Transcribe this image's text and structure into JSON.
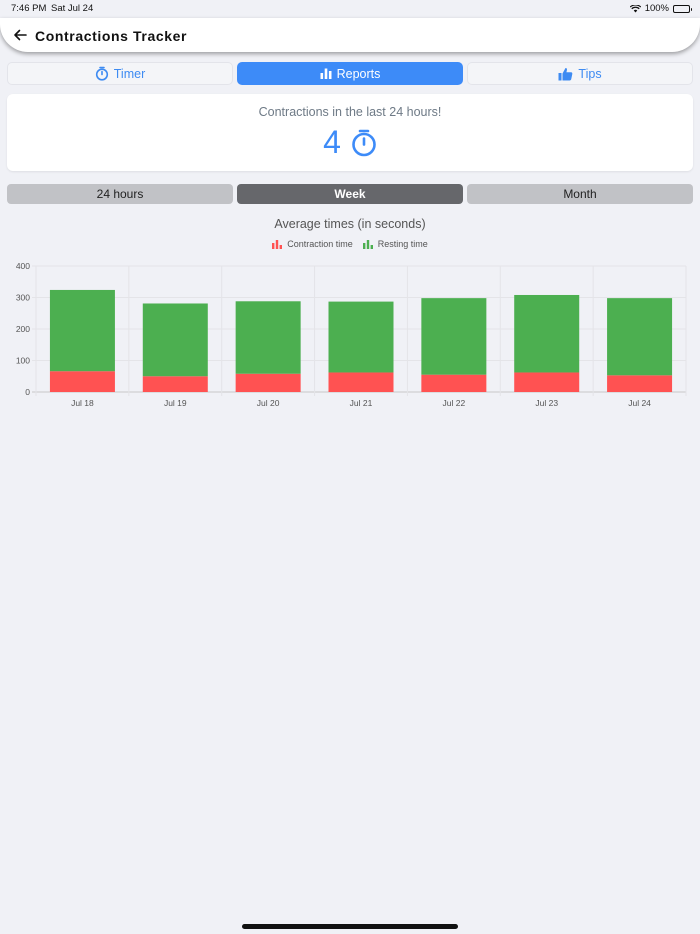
{
  "status_bar": {
    "time": "7:46 PM",
    "date": "Sat Jul 24",
    "battery": "100%"
  },
  "header": {
    "title": "Contractions Tracker"
  },
  "tabs": [
    {
      "label": "Timer",
      "icon": "stopwatch-icon"
    },
    {
      "label": "Reports",
      "icon": "bar-chart-icon",
      "active": true
    },
    {
      "label": "Tips",
      "icon": "thumbs-up-icon"
    }
  ],
  "summary": {
    "label": "Contractions in the last 24 hours!",
    "count": "4"
  },
  "periods": [
    {
      "label": "24 hours"
    },
    {
      "label": "Week",
      "active": true
    },
    {
      "label": "Month"
    }
  ],
  "colors": {
    "accent": "#3d8bf8",
    "contraction": "#ff5252",
    "resting": "#4caf50"
  },
  "chart_data": {
    "type": "bar",
    "stacked": true,
    "title": "Average times (in seconds)",
    "categories": [
      "Jul 18",
      "Jul 19",
      "Jul 20",
      "Jul 21",
      "Jul 22",
      "Jul 23",
      "Jul 24"
    ],
    "series": [
      {
        "name": "Contraction time",
        "color": "#ff5252",
        "values": [
          66,
          50,
          58,
          62,
          55,
          62,
          53
        ]
      },
      {
        "name": "Resting time",
        "color": "#4caf50",
        "values": [
          258,
          231,
          230,
          225,
          243,
          246,
          245
        ]
      }
    ],
    "ylim": [
      0,
      400
    ],
    "yticks": [
      0,
      100,
      200,
      300,
      400
    ],
    "grid": true,
    "legend_position": "top"
  }
}
